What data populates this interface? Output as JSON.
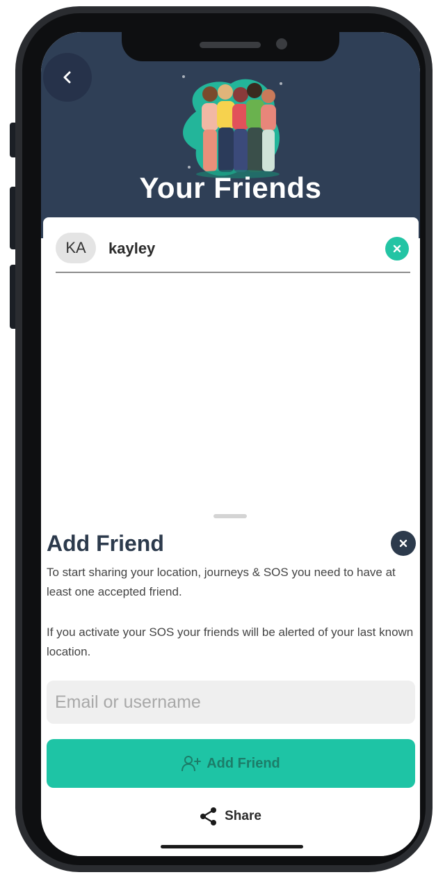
{
  "header": {
    "title": "Your Friends"
  },
  "friends": [
    {
      "initials": "KA",
      "name": "kayley"
    }
  ],
  "add_friend_sheet": {
    "title": "Add Friend",
    "description_1": "To start sharing your location, journeys & SOS you need to have at least one accepted friend.",
    "description_2": "If you activate your SOS your friends will be alerted of your last known location.",
    "input_placeholder": "Email or username",
    "add_button_label": "Add Friend",
    "share_label": "Share"
  },
  "colors": {
    "header_bg": "#2f3f56",
    "accent": "#1ec4a5",
    "title_dark": "#2c3a4c"
  },
  "icons": {
    "back": "chevron-left-icon",
    "remove": "close-icon",
    "close": "close-icon",
    "add_friend": "person-add-icon",
    "share": "share-icon"
  }
}
